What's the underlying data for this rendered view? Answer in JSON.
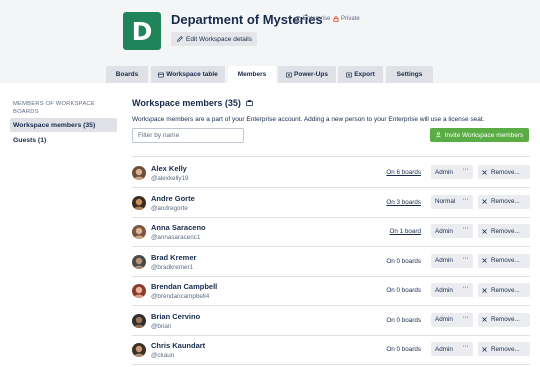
{
  "header": {
    "logo_letter": "D",
    "title": "Department of Mysteries",
    "badge_enterprise": "Enterprise",
    "badge_private": "Private",
    "edit_label": "Edit Workspace details"
  },
  "tabs": [
    {
      "label": "Boards"
    },
    {
      "label": "Workspace table"
    },
    {
      "label": "Members"
    },
    {
      "label": "Power-Ups"
    },
    {
      "label": "Export"
    },
    {
      "label": "Settings"
    }
  ],
  "sidebar": {
    "heading": "MEMBERS OF WORKSPACE BOARDS",
    "items": [
      {
        "label": "Workspace members (35)"
      },
      {
        "label": "Guests (1)"
      }
    ]
  },
  "main": {
    "title": "Workspace members (35)",
    "description": "Workspace members are a part of your Enterprise account. Adding a new person to your Enterprise will use a license seat.",
    "filter_placeholder": "Filter by name",
    "invite_label": "Invite Workspace members",
    "remove_label": "Remove...",
    "dots": "···",
    "members": [
      {
        "name": "Alex Kelly",
        "username": "@alexkelly19",
        "boards": "On 6 boards",
        "role": "Admin"
      },
      {
        "name": "Andre Gorte",
        "username": "@andregorte",
        "boards": "On 3 boards",
        "role": "Normal"
      },
      {
        "name": "Anna Saraceno",
        "username": "@annasaracenc1",
        "boards": "On 1 board",
        "role": "Admin"
      },
      {
        "name": "Brad Kremer",
        "username": "@bradkremer1",
        "boards": "On 0 boards",
        "role": "Admin"
      },
      {
        "name": "Brendan Campbell",
        "username": "@brendancampbell4",
        "boards": "On 0 boards",
        "role": "Admin"
      },
      {
        "name": "Brian Cervino",
        "username": "@brian",
        "boards": "On 0 boards",
        "role": "Admin"
      },
      {
        "name": "Chris Kaundart",
        "username": "@ckaun",
        "boards": "On 0 boards",
        "role": "Admin"
      }
    ]
  },
  "colors": {
    "logo": "#1f845a",
    "invite": "#5aac44",
    "header_bg": "#f4f5f7"
  }
}
